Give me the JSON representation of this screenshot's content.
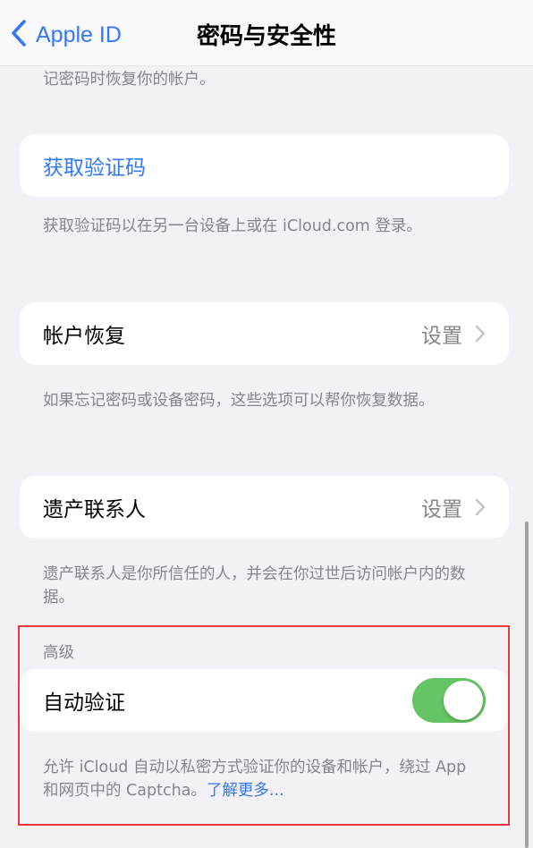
{
  "navbar": {
    "back_label": "Apple ID",
    "title": "密码与安全性"
  },
  "sections": {
    "top_footer_partial": "记密码时恢复你的帐户。",
    "verification": {
      "cell_label": "获取验证码",
      "footer": "获取验证码以在另一台设备上或在 iCloud.com 登录。"
    },
    "account_recovery": {
      "cell_label": "帐户恢复",
      "cell_value": "设置",
      "footer": "如果忘记密码或设备密码，这些选项可以帮你恢复数据。"
    },
    "legacy_contact": {
      "cell_label": "遗产联系人",
      "cell_value": "设置",
      "footer": "遗产联系人是你所信任的人，并会在你过世后访问帐户内的数据。"
    },
    "advanced": {
      "header": "高级",
      "cell_label": "自动验证",
      "toggle_on": true,
      "footer_text": "允许 iCloud 自动以私密方式验证你的设备和帐户，绕过 App 和网页中的 Captcha。",
      "footer_link": "了解更多..."
    }
  },
  "colors": {
    "accent": "#3478f6",
    "toggle_on": "#65c466",
    "background": "#f2f1f6",
    "highlight": "#e8393f"
  }
}
